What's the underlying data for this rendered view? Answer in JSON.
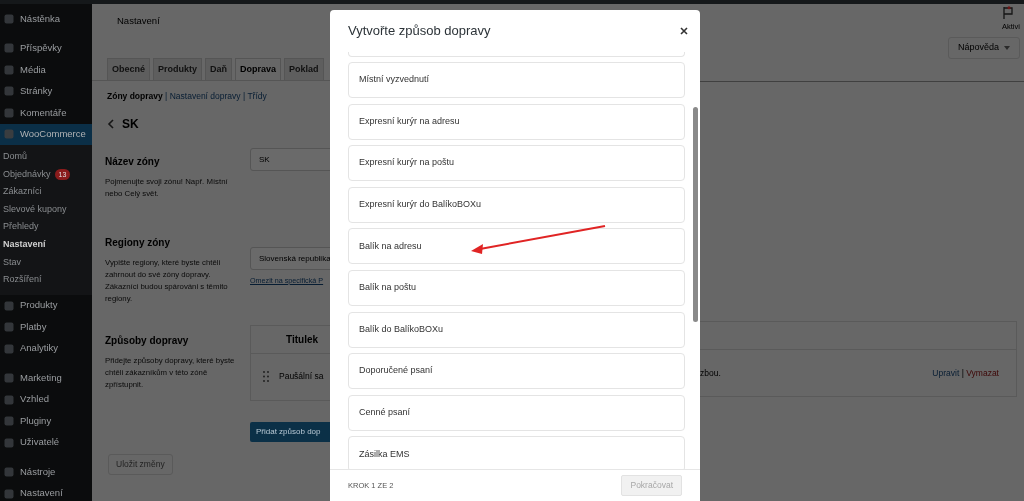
{
  "sidebar": {
    "items": [
      {
        "label": "Nástěnka",
        "selected": false
      },
      {
        "label": "Příspěvky",
        "selected": false
      },
      {
        "label": "Média",
        "selected": false
      },
      {
        "label": "Stránky",
        "selected": false
      },
      {
        "label": "Komentáře",
        "selected": false
      },
      {
        "label": "WooCommerce",
        "selected": true,
        "children": [
          {
            "label": "Domů",
            "selected": false
          },
          {
            "label": "Objednávky",
            "badge": "13",
            "selected": false
          },
          {
            "label": "Zákazníci",
            "selected": false
          },
          {
            "label": "Slevové kupony",
            "selected": false
          },
          {
            "label": "Přehledy",
            "selected": false
          },
          {
            "label": "Nastavení",
            "selected": true
          },
          {
            "label": "Stav",
            "selected": false
          },
          {
            "label": "Rozšíření",
            "selected": false
          }
        ]
      },
      {
        "label": "Produkty",
        "selected": false
      },
      {
        "label": "Platby",
        "selected": false
      },
      {
        "label": "Analytiky",
        "selected": false
      },
      {
        "label": "Marketing",
        "selected": false
      },
      {
        "label": "Vzhled",
        "selected": false
      },
      {
        "label": "Pluginy",
        "selected": false
      },
      {
        "label": "Uživatelé",
        "selected": false
      },
      {
        "label": "Nástroje",
        "selected": false
      },
      {
        "label": "Nastavení",
        "selected": false
      }
    ]
  },
  "header": {
    "title": "Nastavení",
    "activity": "Aktivi",
    "help_button": "Nápověda"
  },
  "tabs": [
    {
      "label": "Obecné",
      "selected": false
    },
    {
      "label": "Produkty",
      "selected": false
    },
    {
      "label": "Daň",
      "selected": false
    },
    {
      "label": "Doprava",
      "selected": true
    },
    {
      "label": "Poklad",
      "selected": false
    }
  ],
  "subnav_separator": "|",
  "subnav": [
    {
      "label": "Zóny dopravy",
      "selected": true
    },
    {
      "label": "Nastavení dopravy",
      "selected": false
    },
    {
      "label": "Třídy",
      "selected": false
    }
  ],
  "zone": {
    "name": "SK",
    "zone_name": {
      "label": "Název zóny",
      "description": "Pojmenujte svoji zónu! Např. Místní nebo Celý svět.",
      "value": "SK"
    },
    "regions": {
      "label": "Regiony zóny",
      "description": "Vypište regiony, které byste chtěli zahrnout do své zóny dopravy. Zákazníci budou spárováni s těmito regiony.",
      "value": "Slovenská republika",
      "link": "Omezit na specifická P"
    },
    "methods": {
      "label": "Způsoby dopravy",
      "description": "Přidejte způsoby dopravy, které byste chtěli zákazníkům v této zóně zpřístupnit.",
      "table": {
        "columns": [
          "Titulek"
        ],
        "rows": [
          {
            "cells": [
              "Paušální sa",
              "zbou."
            ],
            "actions": [
              "Upravit",
              "Vymazat"
            ],
            "action_separator": "|"
          }
        ]
      },
      "add_button": "Přidat způsob dop"
    }
  },
  "save_button": {
    "label": "Uložit změny",
    "disabled": true
  },
  "modal": {
    "title": "Vytvořte způsob dopravy",
    "options": [
      "Místní vyzvednutí",
      "Expresní kurýr na adresu",
      "Expresní kurýr na poštu",
      "Expresní kurýr do BalíkoBOXu",
      "Balík na adresu",
      "Balík na poštu",
      "Balík do BalíkoBOXu",
      "Doporučené psaní",
      "Cenné psaní",
      "Zásilka EMS"
    ],
    "step": "KROK 1 ZE 2",
    "continue_button": {
      "label": "Pokračovat",
      "disabled": true
    }
  }
}
